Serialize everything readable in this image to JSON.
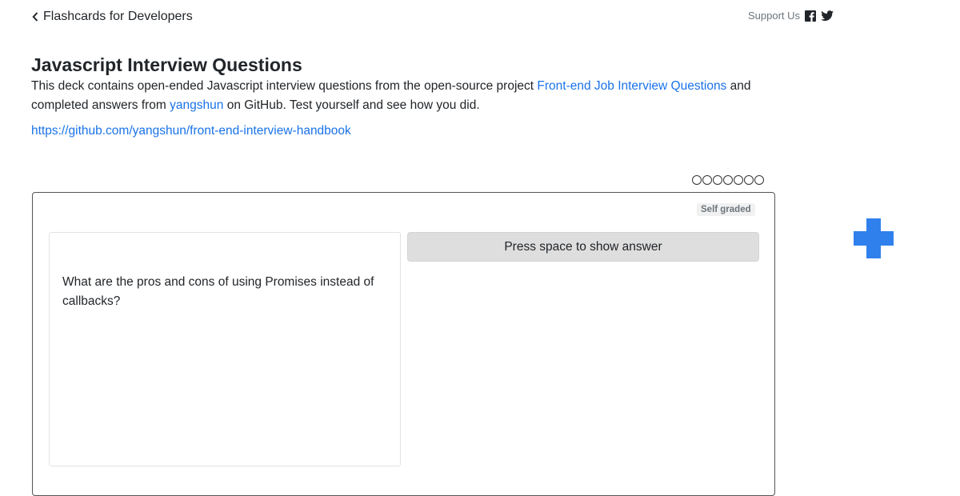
{
  "nav": {
    "back_label": "Flashcards for Developers",
    "support_label": "Support Us",
    "icons": [
      "chevron-left-icon",
      "facebook-icon",
      "twitter-icon"
    ]
  },
  "deck": {
    "title": "Javascript Interview Questions",
    "desc_part1": "This deck contains open-ended Javascript interview questions from the open-source project ",
    "desc_link1": "Front-end Job Interview Questions",
    "desc_part2": " and completed answers from ",
    "desc_link2": "yangshun",
    "desc_part3": " on GitHub. Test yourself and see how you did.",
    "repo_url": "https://github.com/yangshun/front-end-interview-handbook"
  },
  "progress": {
    "total_cards": 7,
    "completed": 0
  },
  "card": {
    "badge": "Self graded",
    "question": "What are the pros and cons of using Promises instead of callbacks?",
    "answer_button": "Press space to show answer"
  },
  "colors": {
    "link": "#1a73e8",
    "plus": "#2f80ed",
    "button_bg": "#dedede"
  }
}
